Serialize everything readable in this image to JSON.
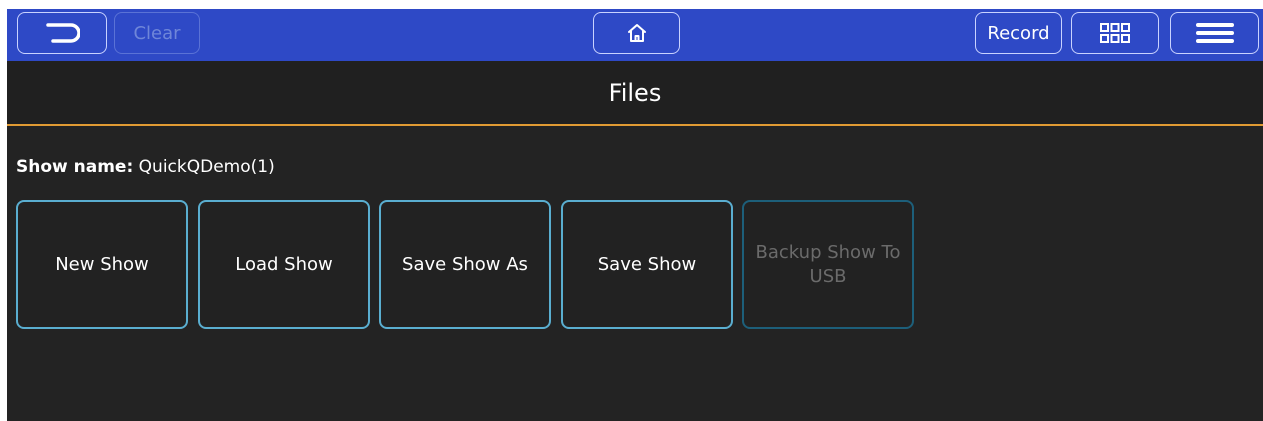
{
  "toolbar": {
    "back_icon": "undo-arrow-icon",
    "clear_label": "Clear",
    "home_icon": "home-icon",
    "record_label": "Record",
    "grid_icon": "grid-icon",
    "menu_icon": "hamburger-menu-icon"
  },
  "title": "Files",
  "show": {
    "label": "Show name:",
    "value": "QuickQDemo(1)"
  },
  "actions": [
    {
      "label": "New Show",
      "enabled": true
    },
    {
      "label": "Load Show",
      "enabled": true
    },
    {
      "label": "Save Show As",
      "enabled": true
    },
    {
      "label": "Save Show",
      "enabled": true
    },
    {
      "label": "Backup Show To USB",
      "enabled": false
    }
  ],
  "colors": {
    "toolbar_bg": "#2e49c6",
    "page_bg": "#232323",
    "accent_line": "#e09a33",
    "button_border": "#5aaed0",
    "disabled_text": "#6b6b6b"
  }
}
